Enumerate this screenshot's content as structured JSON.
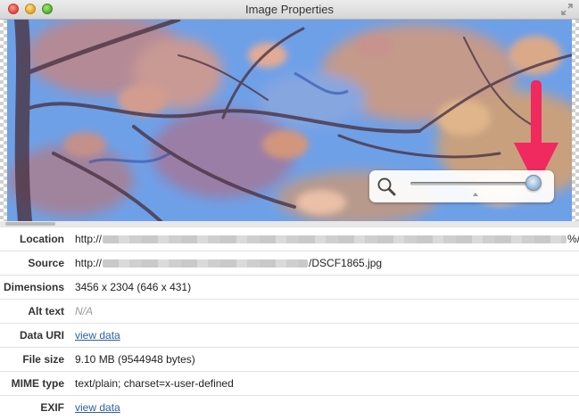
{
  "window": {
    "title": "Image Properties"
  },
  "preview": {
    "zoom_level_fraction": 1.0
  },
  "properties": [
    {
      "label": "Location",
      "prefix": "http://",
      "suffix": "%/"
    },
    {
      "label": "Source",
      "prefix": "http://",
      "suffix": "/DSCF1865.jpg"
    },
    {
      "label": "Dimensions",
      "value": "3456 x 2304 (646 x 431)"
    },
    {
      "label": "Alt text",
      "value": "N/A"
    },
    {
      "label": "Data URI",
      "link": "view data"
    },
    {
      "label": "File size",
      "value": "9.10 MB (9544948 bytes)"
    },
    {
      "label": "MIME type",
      "value": "text/plain; charset=x-user-defined"
    },
    {
      "label": "EXIF",
      "link": "view data"
    }
  ],
  "colors": {
    "link": "#2b5ea7",
    "arrow": "#f0295e",
    "sky": "#6ea0e8"
  },
  "icons": [
    "close-button",
    "minimize-button",
    "maximize-button",
    "fullscreen-icon",
    "magnifier-icon",
    "arrow-annotation"
  ]
}
